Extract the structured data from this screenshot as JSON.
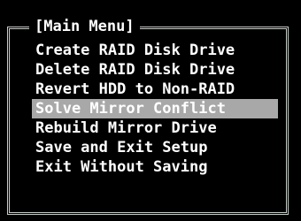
{
  "menu": {
    "title": "[Main Menu]",
    "selected_index": 3,
    "items": [
      {
        "label": "Create RAID Disk Drive"
      },
      {
        "label": "Delete RAID Disk Drive"
      },
      {
        "label": "Revert HDD to Non-RAID"
      },
      {
        "label": "Solve Mirror Conflict"
      },
      {
        "label": "Rebuild Mirror Drive"
      },
      {
        "label": "Save and Exit Setup"
      },
      {
        "label": "Exit Without Saving"
      }
    ]
  },
  "colors": {
    "background": "#000000",
    "text": "#ffffff",
    "highlight": "#a8a8a8",
    "border": "#c6cbc6"
  }
}
